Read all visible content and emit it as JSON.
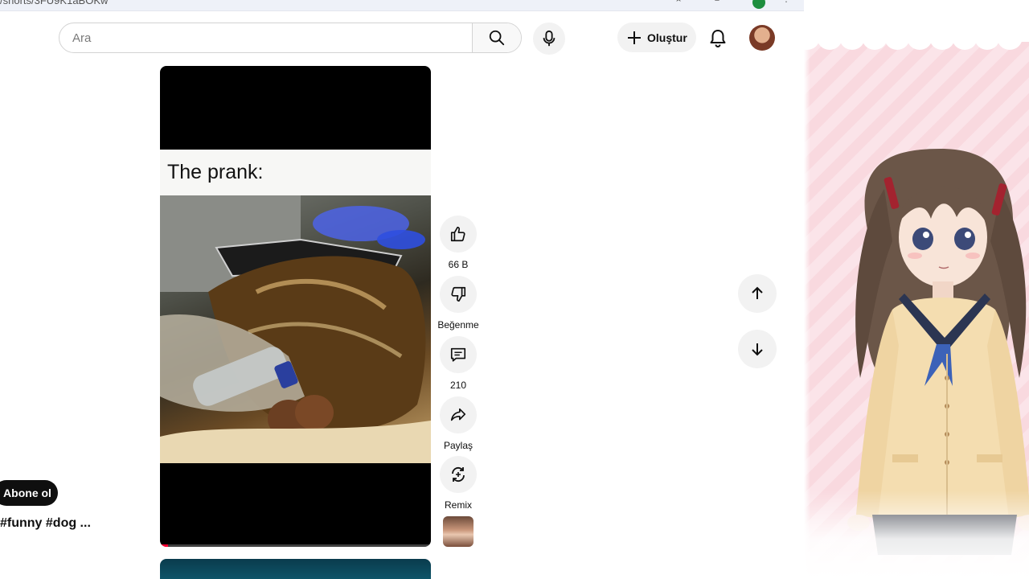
{
  "browser": {
    "url_fragment": "/shorts/3FU9K1aBOKw"
  },
  "header": {
    "search_placeholder": "Ara",
    "create_label": "Oluştur"
  },
  "short": {
    "caption": "The prank:",
    "progress": 0.03,
    "title": "#funny #dog ...",
    "subscribe_label": "Abone ol"
  },
  "actions": {
    "like_count": "66 B",
    "dislike_label": "Beğenme",
    "comment_count": "210",
    "share_label": "Paylaş",
    "remix_label": "Remix"
  },
  "colors": {
    "progress": "#ff0033",
    "subscribe_bg": "#0f0f0f",
    "button_bg": "#f2f2f2"
  },
  "icons": [
    "search-icon",
    "mic-icon",
    "plus-icon",
    "bell-icon",
    "thumb-up-icon",
    "thumb-down-icon",
    "comment-icon",
    "share-icon",
    "remix-icon",
    "arrow-up-icon",
    "arrow-down-icon"
  ]
}
